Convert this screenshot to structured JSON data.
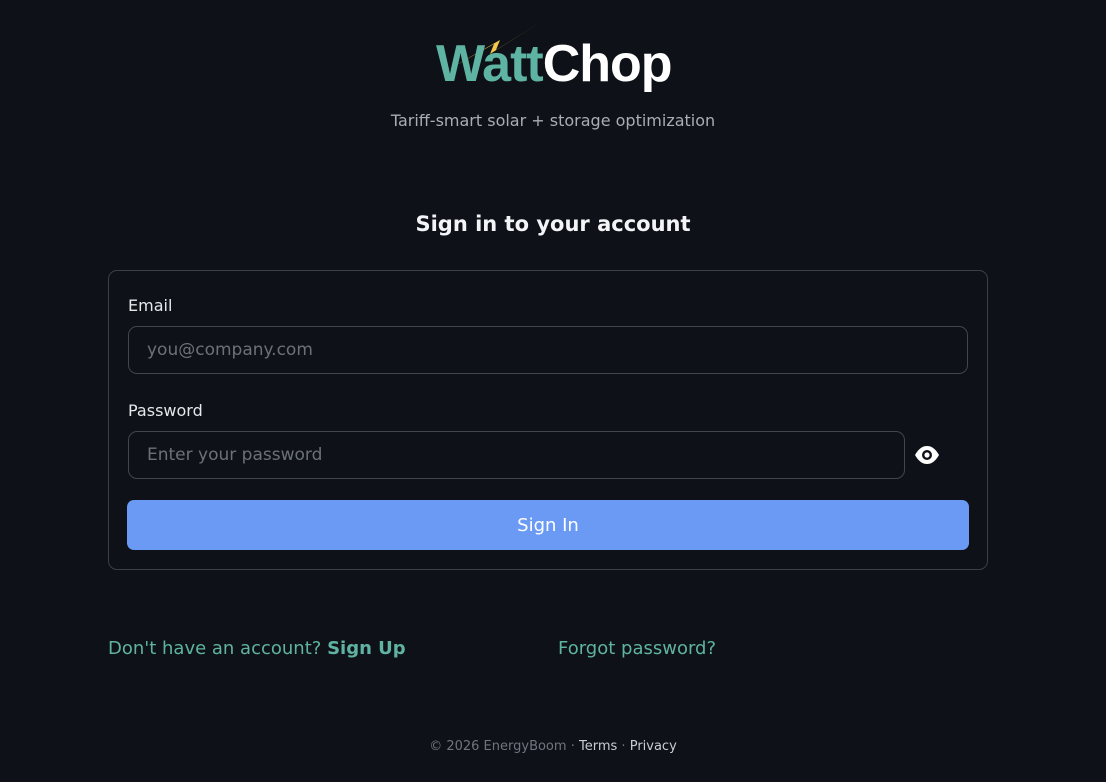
{
  "brand": {
    "name_part1": "Watt",
    "name_part2": "Chop",
    "tagline": "Tariff-smart solar + storage optimization",
    "colors": {
      "teal": "#5fb3a3",
      "bolt": "#f2c94c"
    }
  },
  "heading": "Sign in to your account",
  "form": {
    "email_label": "Email",
    "email_placeholder": "you@company.com",
    "email_value": "",
    "password_label": "Password",
    "password_placeholder": "Enter your password",
    "password_value": "",
    "toggle_icon": "eye-icon",
    "submit_label": "Sign In",
    "submit_color": "#6b9af5"
  },
  "links": {
    "signup_prompt": "Don't have an account?",
    "signup_label": "Sign Up",
    "forgot_label": "Forgot password?"
  },
  "footer": {
    "copyright": "© 2026 EnergyBoom",
    "separator": "·",
    "terms_label": "Terms",
    "privacy_label": "Privacy"
  }
}
